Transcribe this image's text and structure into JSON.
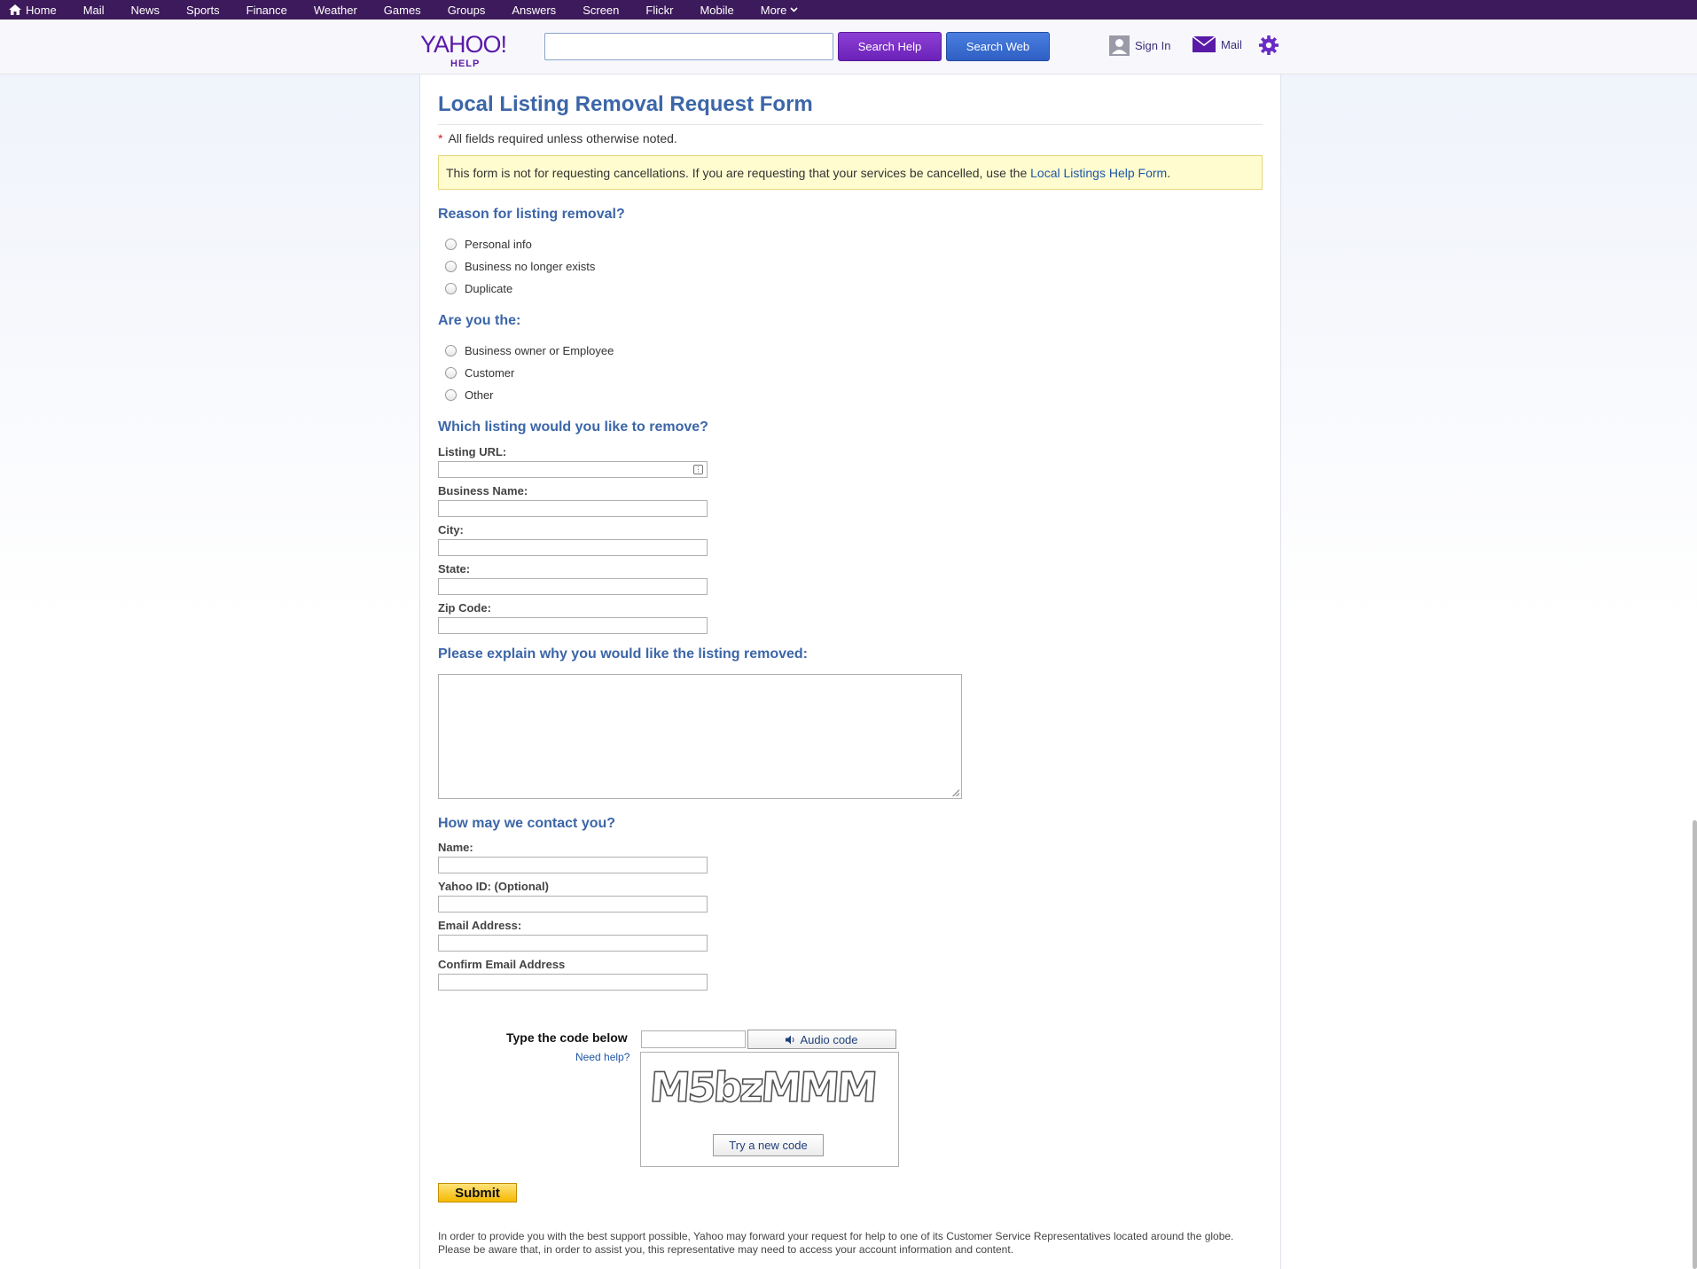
{
  "topnav": {
    "items": [
      "Home",
      "Mail",
      "News",
      "Sports",
      "Finance",
      "Weather",
      "Games",
      "Groups",
      "Answers",
      "Screen",
      "Flickr",
      "Mobile",
      "More"
    ]
  },
  "header": {
    "logo_text": "YAHOO!",
    "logo_sub": "HELP",
    "search_value": "",
    "search_help_label": "Search Help",
    "search_web_label": "Search Web",
    "signin_label": "Sign In",
    "mail_label": "Mail"
  },
  "form": {
    "title": "Local Listing Removal Request Form",
    "required_note": "All fields required unless otherwise noted.",
    "required_star": "*",
    "notice_text": "This form is not for requesting cancellations. If you are requesting that your services be cancelled, use the ",
    "notice_link": "Local Listings Help Form",
    "notice_end": ".",
    "reason": {
      "heading": "Reason for listing removal?",
      "options": [
        "Personal info",
        "Business no longer exists",
        "Duplicate"
      ]
    },
    "role": {
      "heading": "Are you the:",
      "options": [
        "Business owner or Employee",
        "Customer",
        "Other"
      ]
    },
    "listing": {
      "heading": "Which listing would you like to remove?",
      "fields": [
        "Listing URL:",
        "Business Name:",
        "City:",
        "State:",
        "Zip Code:"
      ]
    },
    "explain": {
      "heading": "Please explain why you would like the listing removed:"
    },
    "contact": {
      "heading": "How may we contact you?",
      "fields": [
        "Name:",
        "Yahoo ID: (Optional)",
        "Email Address:",
        "Confirm Email Address"
      ]
    },
    "captcha": {
      "label": "Type the code below",
      "need_help": "Need help?",
      "audio_label": "Audio code",
      "code_text": "M5bzMMM",
      "try_new": "Try a new code"
    },
    "submit_label": "Submit",
    "footer_text": "In order to provide you with the best support possible, Yahoo may forward your request for help to one of its Customer Service Representatives located around the globe. Please be aware that, in order to assist you, this representative may need to access your account information and content."
  },
  "colors": {
    "nav_bg": "#3d1a5b",
    "heading_blue": "#3c66a8",
    "link_blue": "#1f56a8",
    "help_button": "#7a30c8",
    "web_button": "#3b6fd4",
    "submit_yellow": "#f5c000"
  },
  "icons": {
    "home": "home-icon",
    "user": "user-icon",
    "mail": "mail-icon",
    "settings": "gear-icon",
    "audio": "speaker-icon"
  }
}
